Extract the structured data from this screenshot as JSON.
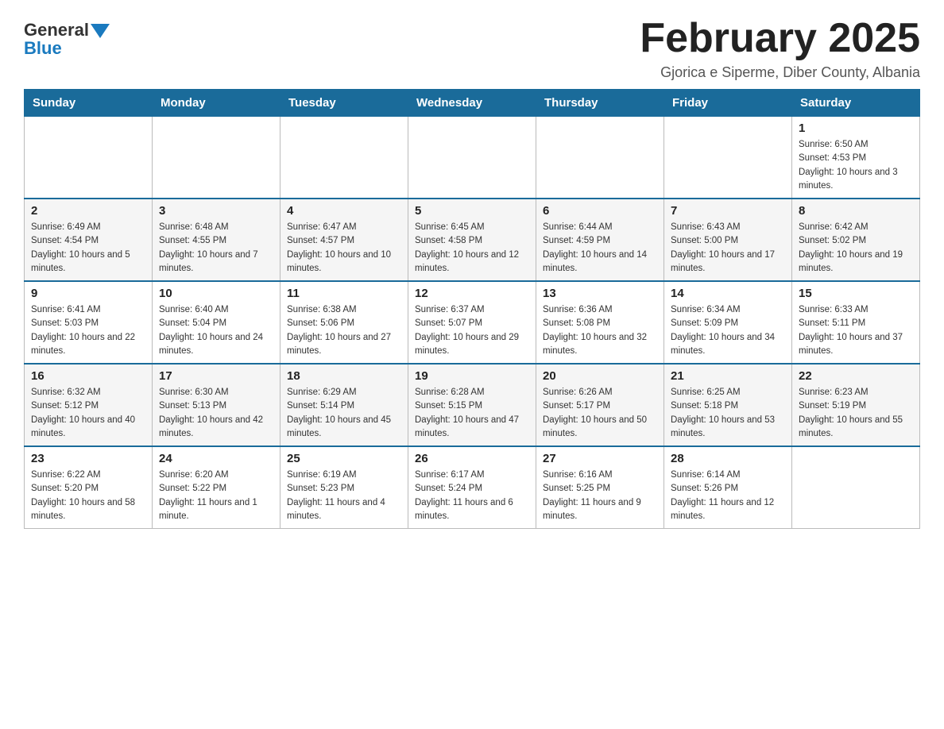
{
  "header": {
    "logo": {
      "general": "General",
      "blue": "Blue"
    },
    "title": "February 2025",
    "subtitle": "Gjorica e Siperme, Diber County, Albania"
  },
  "days_of_week": [
    "Sunday",
    "Monday",
    "Tuesday",
    "Wednesday",
    "Thursday",
    "Friday",
    "Saturday"
  ],
  "weeks": [
    {
      "days": [
        {
          "number": "",
          "info": ""
        },
        {
          "number": "",
          "info": ""
        },
        {
          "number": "",
          "info": ""
        },
        {
          "number": "",
          "info": ""
        },
        {
          "number": "",
          "info": ""
        },
        {
          "number": "",
          "info": ""
        },
        {
          "number": "1",
          "info": "Sunrise: 6:50 AM\nSunset: 4:53 PM\nDaylight: 10 hours and 3 minutes."
        }
      ]
    },
    {
      "days": [
        {
          "number": "2",
          "info": "Sunrise: 6:49 AM\nSunset: 4:54 PM\nDaylight: 10 hours and 5 minutes."
        },
        {
          "number": "3",
          "info": "Sunrise: 6:48 AM\nSunset: 4:55 PM\nDaylight: 10 hours and 7 minutes."
        },
        {
          "number": "4",
          "info": "Sunrise: 6:47 AM\nSunset: 4:57 PM\nDaylight: 10 hours and 10 minutes."
        },
        {
          "number": "5",
          "info": "Sunrise: 6:45 AM\nSunset: 4:58 PM\nDaylight: 10 hours and 12 minutes."
        },
        {
          "number": "6",
          "info": "Sunrise: 6:44 AM\nSunset: 4:59 PM\nDaylight: 10 hours and 14 minutes."
        },
        {
          "number": "7",
          "info": "Sunrise: 6:43 AM\nSunset: 5:00 PM\nDaylight: 10 hours and 17 minutes."
        },
        {
          "number": "8",
          "info": "Sunrise: 6:42 AM\nSunset: 5:02 PM\nDaylight: 10 hours and 19 minutes."
        }
      ]
    },
    {
      "days": [
        {
          "number": "9",
          "info": "Sunrise: 6:41 AM\nSunset: 5:03 PM\nDaylight: 10 hours and 22 minutes."
        },
        {
          "number": "10",
          "info": "Sunrise: 6:40 AM\nSunset: 5:04 PM\nDaylight: 10 hours and 24 minutes."
        },
        {
          "number": "11",
          "info": "Sunrise: 6:38 AM\nSunset: 5:06 PM\nDaylight: 10 hours and 27 minutes."
        },
        {
          "number": "12",
          "info": "Sunrise: 6:37 AM\nSunset: 5:07 PM\nDaylight: 10 hours and 29 minutes."
        },
        {
          "number": "13",
          "info": "Sunrise: 6:36 AM\nSunset: 5:08 PM\nDaylight: 10 hours and 32 minutes."
        },
        {
          "number": "14",
          "info": "Sunrise: 6:34 AM\nSunset: 5:09 PM\nDaylight: 10 hours and 34 minutes."
        },
        {
          "number": "15",
          "info": "Sunrise: 6:33 AM\nSunset: 5:11 PM\nDaylight: 10 hours and 37 minutes."
        }
      ]
    },
    {
      "days": [
        {
          "number": "16",
          "info": "Sunrise: 6:32 AM\nSunset: 5:12 PM\nDaylight: 10 hours and 40 minutes."
        },
        {
          "number": "17",
          "info": "Sunrise: 6:30 AM\nSunset: 5:13 PM\nDaylight: 10 hours and 42 minutes."
        },
        {
          "number": "18",
          "info": "Sunrise: 6:29 AM\nSunset: 5:14 PM\nDaylight: 10 hours and 45 minutes."
        },
        {
          "number": "19",
          "info": "Sunrise: 6:28 AM\nSunset: 5:15 PM\nDaylight: 10 hours and 47 minutes."
        },
        {
          "number": "20",
          "info": "Sunrise: 6:26 AM\nSunset: 5:17 PM\nDaylight: 10 hours and 50 minutes."
        },
        {
          "number": "21",
          "info": "Sunrise: 6:25 AM\nSunset: 5:18 PM\nDaylight: 10 hours and 53 minutes."
        },
        {
          "number": "22",
          "info": "Sunrise: 6:23 AM\nSunset: 5:19 PM\nDaylight: 10 hours and 55 minutes."
        }
      ]
    },
    {
      "days": [
        {
          "number": "23",
          "info": "Sunrise: 6:22 AM\nSunset: 5:20 PM\nDaylight: 10 hours and 58 minutes."
        },
        {
          "number": "24",
          "info": "Sunrise: 6:20 AM\nSunset: 5:22 PM\nDaylight: 11 hours and 1 minute."
        },
        {
          "number": "25",
          "info": "Sunrise: 6:19 AM\nSunset: 5:23 PM\nDaylight: 11 hours and 4 minutes."
        },
        {
          "number": "26",
          "info": "Sunrise: 6:17 AM\nSunset: 5:24 PM\nDaylight: 11 hours and 6 minutes."
        },
        {
          "number": "27",
          "info": "Sunrise: 6:16 AM\nSunset: 5:25 PM\nDaylight: 11 hours and 9 minutes."
        },
        {
          "number": "28",
          "info": "Sunrise: 6:14 AM\nSunset: 5:26 PM\nDaylight: 11 hours and 12 minutes."
        },
        {
          "number": "",
          "info": ""
        }
      ]
    }
  ]
}
